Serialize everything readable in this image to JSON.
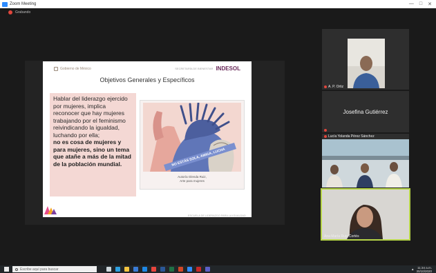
{
  "window": {
    "title": "Zoom Meeting",
    "controls": [
      "—",
      "□",
      "✕"
    ]
  },
  "recording": {
    "label": "Grabando"
  },
  "slide": {
    "gov_label": "Gobierno de México",
    "brand": "INDESOL",
    "brand_small": "SECRETARÍA DE BIENESTAR",
    "title": "Objetivos Generales y Específicos",
    "paragraphs": [
      {
        "text": "Hablar del liderazgo ejercido por mujeres, implica reconocer que hay mujeres trabajando por el feminismo reivindicando la igualdad, luchando por ella;",
        "emph": false
      },
      {
        "text": "no es cosa de mujeres y para mujeres, sino un tema que atañe a más de la mitad de la población mundial.",
        "emph": true
      }
    ],
    "poster_banner": "NO ESTÁS SOLA, AMIGA, LUCHA",
    "poster_caption": [
      "Autoría Glenda Ruiz,",
      "Arte para mujeres"
    ],
    "footer": "ESCUELA DE LIDERAZGO PARA LA IGUALDAD"
  },
  "participants": [
    {
      "name": "A. P. Ortiz",
      "muted": true
    },
    {
      "name": "Josefina Gutiérrez",
      "muted": true
    },
    {
      "name": "Lucía Yolanda Pérez Sánchez",
      "muted": true
    },
    {
      "name": "Ana María Ruiz Cortés",
      "muted": false
    }
  ],
  "taskbar": {
    "search_placeholder": "Escribe aquí para buscar",
    "clock_time": "11:34 a.m.",
    "clock_date": "30/10/2020",
    "apps": [
      {
        "name": "task-view",
        "color": "#cfd8dc"
      },
      {
        "name": "edge",
        "color": "#2ea0df"
      },
      {
        "name": "file-explorer",
        "color": "#f3c440"
      },
      {
        "name": "store",
        "color": "#3a7bd5"
      },
      {
        "name": "mail",
        "color": "#1e88e5"
      },
      {
        "name": "chrome",
        "color": "#e8453c"
      },
      {
        "name": "word",
        "color": "#2b5797"
      },
      {
        "name": "excel",
        "color": "#1e7145"
      },
      {
        "name": "powerpoint",
        "color": "#d24726"
      },
      {
        "name": "zoom",
        "color": "#2d8cff"
      },
      {
        "name": "acrobat",
        "color": "#c62828"
      },
      {
        "name": "teams",
        "color": "#5b5fc7"
      }
    ]
  },
  "colors": {
    "speaker_highlight": "#b7d648",
    "slide_text_box": "#f4d8d4",
    "poster_blue": "#5a6fb0",
    "poster_pink": "#e6a79c"
  }
}
